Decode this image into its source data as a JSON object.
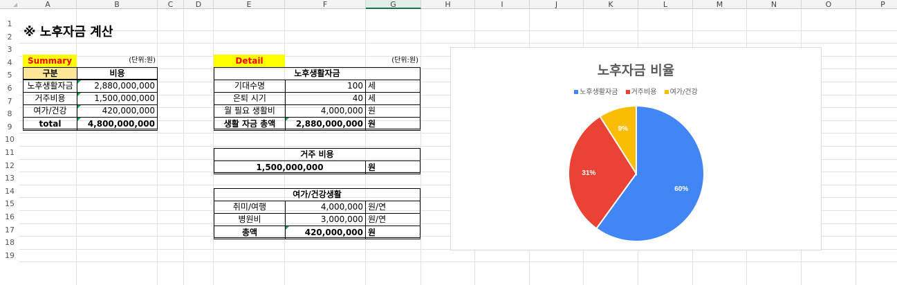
{
  "columns": [
    "A",
    "B",
    "C",
    "D",
    "E",
    "F",
    "G",
    "H",
    "I",
    "J",
    "K",
    "L",
    "M",
    "N",
    "O",
    "P"
  ],
  "rows": [
    "1",
    "2",
    "3",
    "4",
    "5",
    "6",
    "7",
    "8",
    "9",
    "10",
    "11",
    "12",
    "13",
    "14",
    "15",
    "16",
    "17",
    "18",
    "19"
  ],
  "title": "※ 노후자금 계산",
  "summary": {
    "label": "Summary",
    "unit": "(단위:원)",
    "header": [
      "구분",
      "비용"
    ],
    "rows": [
      {
        "name": "노후생활자금",
        "value": "2,880,000,000"
      },
      {
        "name": "거주비용",
        "value": "1,500,000,000"
      },
      {
        "name": "여가/건강",
        "value": "420,000,000"
      }
    ],
    "total": {
      "name": "total",
      "value": "4,800,000,000"
    }
  },
  "detail": {
    "label": "Detail",
    "unit": "(단위:원)",
    "living": {
      "title": "노후생활자금",
      "rows": [
        {
          "name": "기대수명",
          "value": "100",
          "unit": "세"
        },
        {
          "name": "은퇴 시기",
          "value": "40",
          "unit": "세"
        },
        {
          "name": "월 필요 생활비",
          "value": "4,000,000",
          "unit": "원"
        }
      ],
      "total": {
        "name": "생활 자금 총액",
        "value": "2,880,000,000",
        "unit": "원"
      }
    },
    "housing": {
      "title": "거주 비용",
      "value": "1,500,000,000",
      "unit": "원"
    },
    "leisure": {
      "title": "여가/건강생활",
      "rows": [
        {
          "name": "취미/여행",
          "value": "4,000,000",
          "unit": "원/연"
        },
        {
          "name": "병원비",
          "value": "3,000,000",
          "unit": "원/연"
        }
      ],
      "total": {
        "name": "총액",
        "value": "420,000,000",
        "unit": "원"
      }
    }
  },
  "chart_data": {
    "type": "pie",
    "title": "노후자금 비율",
    "categories": [
      "노후생활자금",
      "거주비용",
      "여가/건강"
    ],
    "values": [
      60,
      31,
      9
    ],
    "labels": [
      "60%",
      "31%",
      "9%"
    ],
    "colors": [
      "#4285f4",
      "#ea4335",
      "#fbbc04"
    ],
    "legend": "top"
  }
}
